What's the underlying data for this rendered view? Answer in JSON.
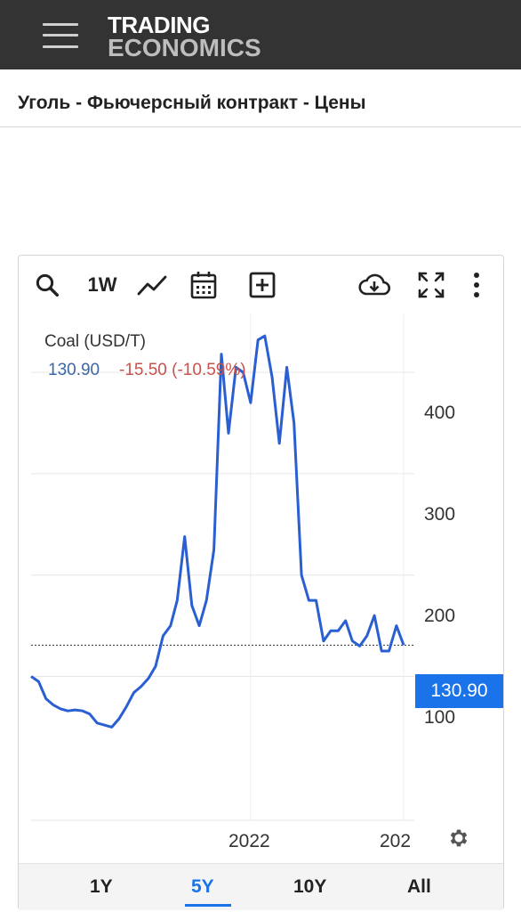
{
  "header": {
    "logo_line1": "TRADING",
    "logo_line2": "ECONOMICS",
    "menu_icon": "hamburger-menu-icon"
  },
  "page": {
    "title": "Уголь - Фьючерсный контракт - Цены"
  },
  "toolbar": {
    "items": [
      {
        "icon": "search-icon"
      },
      {
        "label": "1W"
      },
      {
        "icon": "line-chart-icon"
      },
      {
        "icon": "calendar-icon"
      },
      {
        "icon": "add-box-icon"
      },
      {
        "icon": "cloud-download-icon"
      },
      {
        "icon": "fullscreen-icon"
      },
      {
        "icon": "more-vertical-icon"
      }
    ],
    "period_label": "1W"
  },
  "chart_legend": {
    "name": "Coal (USD/T)",
    "last": "130.90",
    "change": "-15.50 (-10.59%)"
  },
  "price_tag": "130.90",
  "x_ticks": [
    "2022",
    "202"
  ],
  "y_ticks": [
    "400",
    "300",
    "200",
    "100"
  ],
  "range_buttons": [
    "1Y",
    "5Y",
    "10Y",
    "All"
  ],
  "active_range": "5Y",
  "colors": {
    "series": "#2a5fd2",
    "accent": "#1a73e8",
    "negative": "#c9514d",
    "value": "#3b66a8",
    "header_bg": "#333333"
  },
  "chart_data": {
    "type": "line",
    "title": "Coal (USD/T)",
    "xlabel": "",
    "ylabel": "",
    "ylim": [
      0,
      450
    ],
    "x_tick_labels": [
      "2022",
      "202"
    ],
    "y_tick_labels": [
      "100",
      "200",
      "300",
      "400"
    ],
    "grid": true,
    "series": [
      {
        "name": "Coal (USD/T)",
        "x": [
          "2019-07",
          "2019-08",
          "2019-09",
          "2019-10",
          "2019-11",
          "2019-12",
          "2020-01",
          "2020-02",
          "2020-03",
          "2020-04",
          "2020-05",
          "2020-06",
          "2020-07",
          "2020-08",
          "2020-09",
          "2020-10",
          "2020-11",
          "2020-12",
          "2021-01",
          "2021-02",
          "2021-03",
          "2021-04",
          "2021-05",
          "2021-06",
          "2021-07",
          "2021-08",
          "2021-09",
          "2021-10",
          "2021-11",
          "2021-12",
          "2022-01",
          "2022-02",
          "2022-03",
          "2022-04",
          "2022-05",
          "2022-06",
          "2022-07",
          "2022-08",
          "2022-09",
          "2022-10",
          "2022-11",
          "2022-12",
          "2023-01",
          "2023-02",
          "2023-03",
          "2023-04",
          "2023-05",
          "2023-06",
          "2023-07",
          "2023-08",
          "2023-09",
          "2023-10"
        ],
        "values": [
          100,
          95,
          78,
          72,
          68,
          66,
          67,
          66,
          63,
          54,
          52,
          50,
          58,
          70,
          84,
          90,
          98,
          110,
          140,
          150,
          175,
          238,
          170,
          150,
          175,
          225,
          418,
          340,
          405,
          400,
          370,
          432,
          436,
          395,
          330,
          405,
          350,
          200,
          175,
          175,
          135,
          145,
          145,
          155,
          135,
          130,
          140,
          160,
          125,
          125,
          150,
          130.9
        ]
      }
    ],
    "last_value": 130.9
  }
}
